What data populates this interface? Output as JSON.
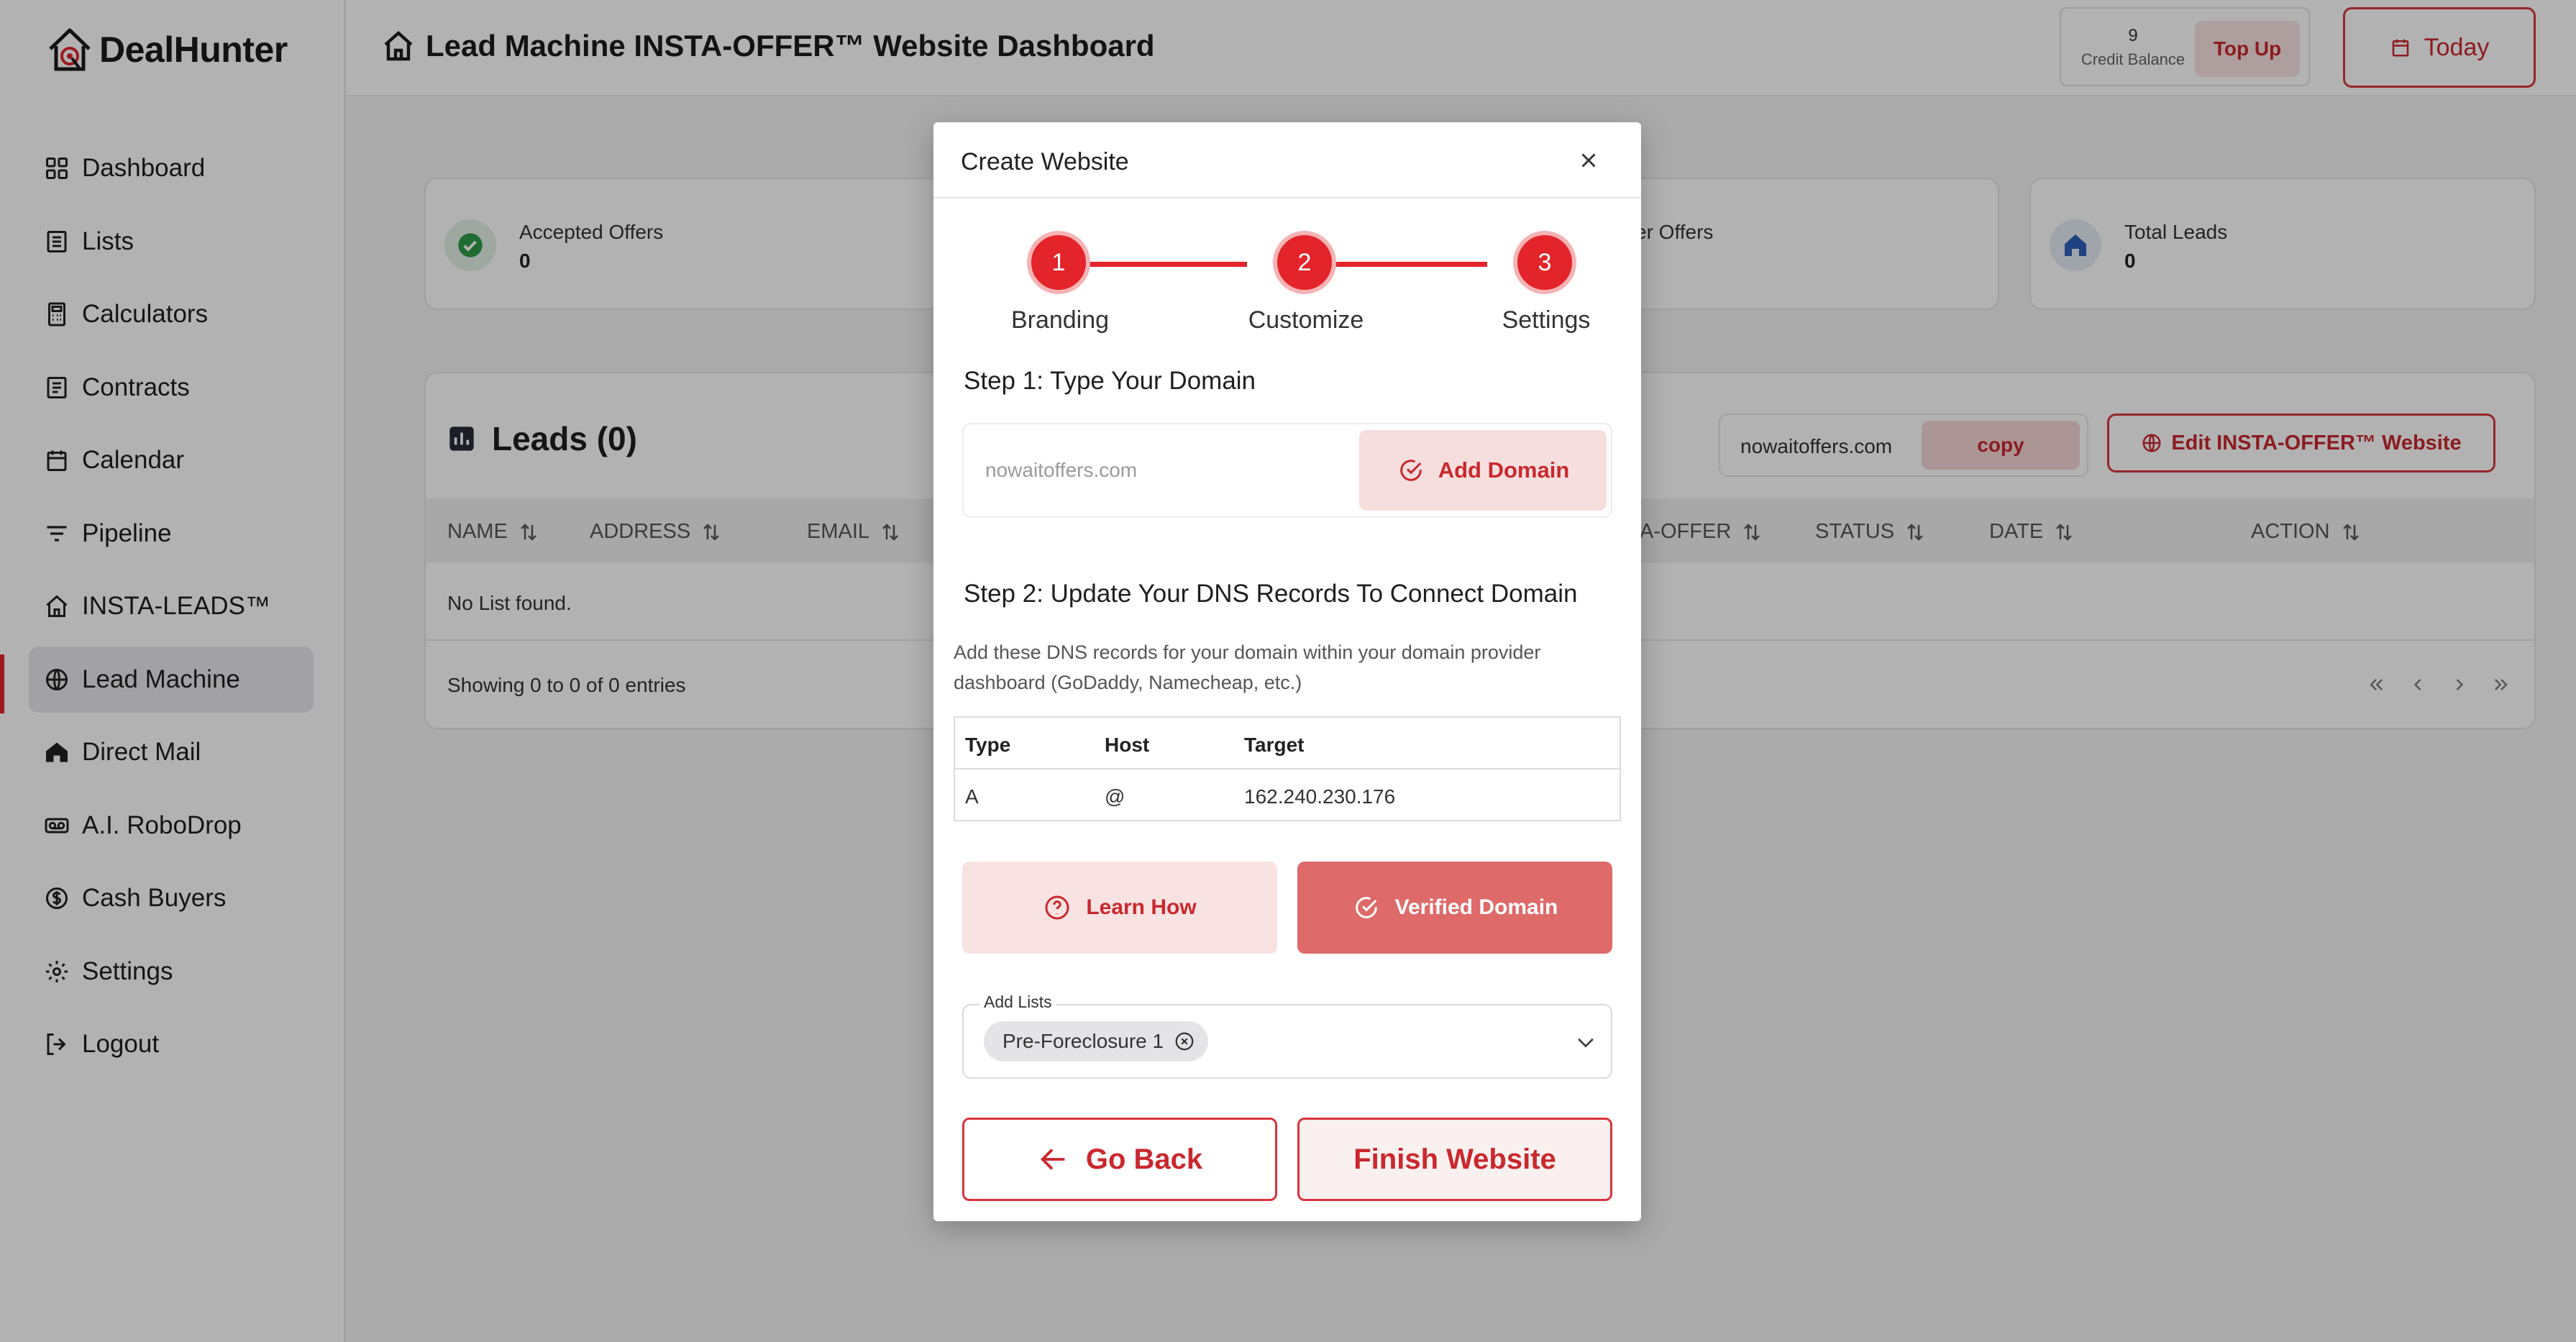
{
  "app": {
    "logo_text": "DealHunter",
    "accent_color": "#e3242b"
  },
  "sidebar": {
    "items": [
      {
        "label": "Dashboard",
        "icon": "grid-icon"
      },
      {
        "label": "Lists",
        "icon": "list-icon"
      },
      {
        "label": "Calculators",
        "icon": "calculator-icon"
      },
      {
        "label": "Contracts",
        "icon": "document-icon"
      },
      {
        "label": "Calendar",
        "icon": "calendar-icon"
      },
      {
        "label": "Pipeline",
        "icon": "filter-icon"
      },
      {
        "label": "INSTA-LEADS™",
        "icon": "home-icon"
      },
      {
        "label": "Lead Machine",
        "icon": "globe-icon",
        "active": true
      },
      {
        "label": "Direct Mail",
        "icon": "mailbox-icon"
      },
      {
        "label": "A.I. RoboDrop",
        "icon": "voicemail-icon"
      },
      {
        "label": "Cash Buyers",
        "icon": "dollar-icon"
      },
      {
        "label": "Settings",
        "icon": "gear-icon"
      },
      {
        "label": "Logout",
        "icon": "logout-icon"
      }
    ]
  },
  "header": {
    "title": "Lead Machine INSTA-OFFER™ Website Dashboard",
    "credit_value": "9",
    "credit_label": "Credit Balance",
    "topup_label": "Top Up",
    "today_label": "Today"
  },
  "cards": [
    {
      "title": "Accepted Offers",
      "value": "0"
    },
    {
      "title": "er Offers",
      "value": ""
    },
    {
      "title": "Total Leads",
      "value": "0"
    }
  ],
  "leads": {
    "title": "Leads (0)",
    "domain": "nowaitoffers.com",
    "copy_label": "copy",
    "edit_label": "Edit INSTA-OFFER™ Website",
    "columns": [
      "NAME",
      "ADDRESS",
      "EMAIL",
      "A-OFFER",
      "STATUS",
      "DATE",
      "ACTION"
    ],
    "empty_text": "No List found.",
    "showing_text": "Showing 0 to 0 of 0 entries"
  },
  "modal": {
    "title": "Create Website",
    "steps": [
      {
        "number": "1",
        "label": "Branding"
      },
      {
        "number": "2",
        "label": "Customize"
      },
      {
        "number": "3",
        "label": "Settings"
      }
    ],
    "step1_heading": "Step 1: Type Your Domain",
    "domain_placeholder": "nowaitoffers.com",
    "add_domain_label": "Add Domain",
    "step2_heading": "Step 2: Update Your DNS Records To Connect Domain",
    "dns_description": "Add these DNS records for your domain within your domain provider dashboard (GoDaddy, Namecheap, etc.)",
    "dns_headers": {
      "type": "Type",
      "host": "Host",
      "target": "Target"
    },
    "dns_row": {
      "type": "A",
      "host": "@",
      "target": "162.240.230.176"
    },
    "learn_how_label": "Learn How",
    "verified_label": "Verified Domain",
    "add_lists_label": "Add Lists",
    "selected_list": "Pre-Foreclosure 1",
    "go_back_label": "Go Back",
    "finish_label": "Finish Website"
  }
}
